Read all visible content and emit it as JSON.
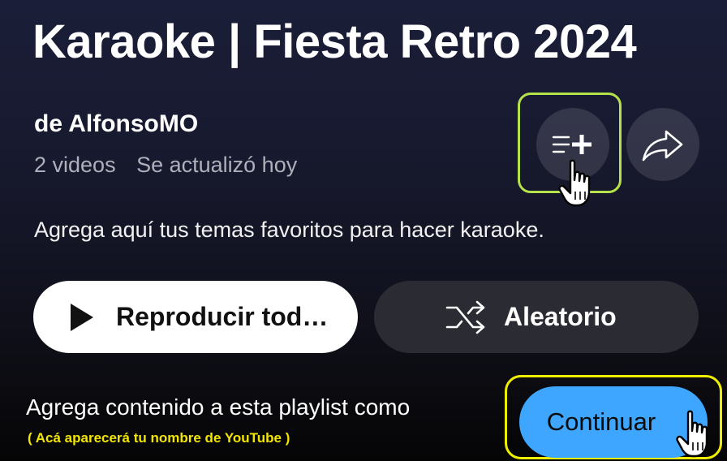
{
  "playlist": {
    "title": "Karaoke | Fiesta Retro 2024",
    "owner": "de AlfonsoMO",
    "video_count": "2 videos",
    "updated": "Se actualizó hoy",
    "description": "Agrega aquí tus temas favoritos para hacer karaoke."
  },
  "actions": {
    "play_all_label": "Reproducir tod…",
    "shuffle_label": "Aleatorio",
    "save_icon": "playlist-add-icon",
    "share_icon": "share-arrow-icon"
  },
  "collab": {
    "prompt": "Agrega contenido a esta playlist como",
    "hint": "( Acá aparecerá tu nombre de YouTube )",
    "continue_label": "Continuar"
  },
  "colors": {
    "accent_blue": "#3ea6ff",
    "highlight_green": "#b5e14a",
    "highlight_yellow": "#eeee00",
    "hint_yellow": "#f2e600"
  }
}
